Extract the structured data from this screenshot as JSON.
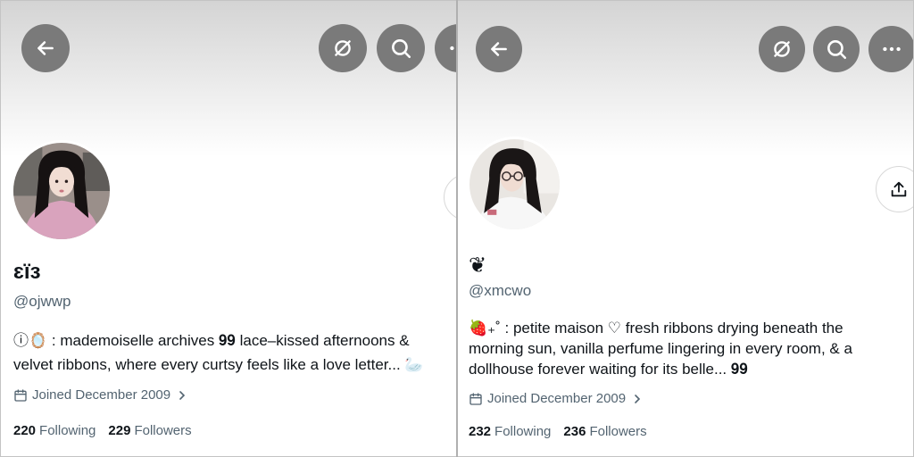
{
  "left_profile": {
    "display_name": "ɛïɜ",
    "handle": "@ojwwp",
    "bio_line1": "ⓘ🪞 :  mademoiselle archives  𝟗𝟗  lace–kissed afternoons &",
    "bio_line2": "velvet ribbons, where every curtsy feels like a love letter...  🦢",
    "joined": "Joined December 2009",
    "following_count": "220",
    "following_label": "Following",
    "followers_count": "229",
    "followers_label": "Followers",
    "icons": [
      "back-arrow-icon",
      "grok-icon",
      "search-icon",
      "more-icon",
      "share-icon"
    ]
  },
  "right_profile": {
    "display_name": "❦",
    "handle": "@xmcwo",
    "bio_line1": "🍓₊˚ :  petite maison  ♡  fresh ribbons drying beneath the",
    "bio_line2": "morning sun, vanilla perfume lingering in every room, & a",
    "bio_line3": "dollhouse forever waiting for its belle...  𝟗𝟗",
    "joined": "Joined December 2009",
    "following_count": "232",
    "following_label": "Following",
    "followers_count": "236",
    "followers_label": "Followers",
    "icons": [
      "back-arrow-icon",
      "grok-icon",
      "search-icon",
      "more-icon",
      "share-icon"
    ]
  },
  "colors": {
    "button_bg": "#7a7a7a",
    "secondary_text": "#536471",
    "primary_text": "#0f1419"
  }
}
